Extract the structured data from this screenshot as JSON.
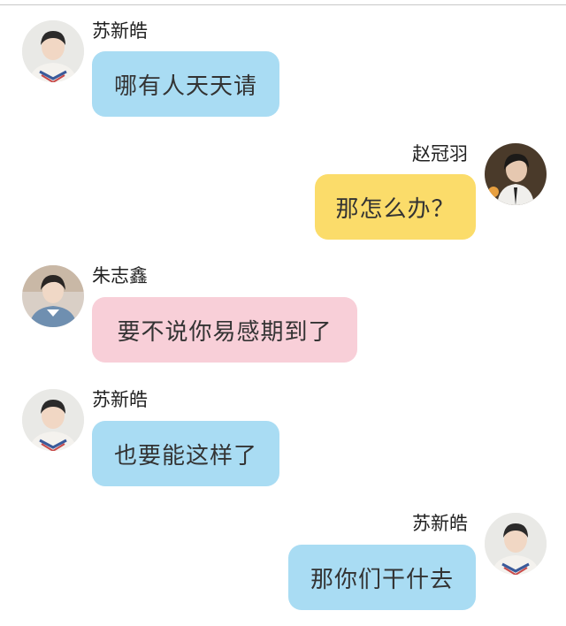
{
  "messages": [
    {
      "sender": "苏新皓",
      "text": "哪有人天天请",
      "side": "left",
      "bubble_color": "#a9dcf3",
      "avatar": "avatar-su-xinhao"
    },
    {
      "sender": "赵冠羽",
      "text": "那怎么办？",
      "side": "right",
      "bubble_color": "#fbdc6a",
      "avatar": "avatar-zhao-guanyu"
    },
    {
      "sender": "朱志鑫",
      "text": "要不说你易感期到了",
      "side": "left",
      "bubble_color": "#f8cfd8",
      "avatar": "avatar-zhu-zhixin"
    },
    {
      "sender": "苏新皓",
      "text": "也要能这样了",
      "side": "left",
      "bubble_color": "#a9dcf3",
      "avatar": "avatar-su-xinhao"
    },
    {
      "sender": "苏新皓",
      "text": "那你们干什去",
      "side": "right",
      "bubble_color": "#a9dcf3",
      "avatar": "avatar-su-xinhao"
    }
  ]
}
